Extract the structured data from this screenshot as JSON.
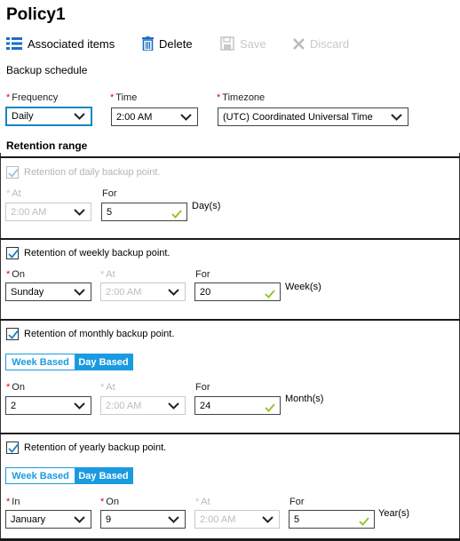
{
  "title": "Policy1",
  "toolbar": {
    "associated_items": "Associated items",
    "delete": "Delete",
    "save": "Save",
    "discard": "Discard"
  },
  "backup_schedule": {
    "heading": "Backup schedule",
    "frequency_label": "Frequency",
    "frequency_value": "Daily",
    "time_label": "Time",
    "time_value": "2:00 AM",
    "timezone_label": "Timezone",
    "timezone_value": "(UTC) Coordinated Universal Time"
  },
  "retention_range": {
    "heading": "Retention range"
  },
  "daily": {
    "checkbox_label": "Retention of daily backup point.",
    "checked": true,
    "disabled": true,
    "at_label": "At",
    "at_value": "2:00 AM",
    "for_label": "For",
    "for_value": "5",
    "unit": "Day(s)"
  },
  "weekly": {
    "checkbox_label": "Retention of weekly backup point.",
    "checked": true,
    "on_label": "On",
    "on_value": "Sunday",
    "at_label": "At",
    "at_value": "2:00 AM",
    "for_label": "For",
    "for_value": "20",
    "unit": "Week(s)"
  },
  "monthly": {
    "checkbox_label": "Retention of monthly backup point.",
    "checked": true,
    "toggle_week": "Week Based",
    "toggle_day": "Day Based",
    "selected": "Day Based",
    "on_label": "On",
    "on_value": "2",
    "at_label": "At",
    "at_value": "2:00 AM",
    "for_label": "For",
    "for_value": "24",
    "unit": "Month(s)"
  },
  "yearly": {
    "checkbox_label": "Retention of yearly backup point.",
    "checked": true,
    "toggle_week": "Week Based",
    "toggle_day": "Day Based",
    "selected": "Day Based",
    "in_label": "In",
    "in_value": "January",
    "on_label": "On",
    "on_value": "9",
    "at_label": "At",
    "at_value": "2:00 AM",
    "for_label": "For",
    "for_value": "5",
    "unit": "Year(s)"
  },
  "colors": {
    "accent": "#1a9be0",
    "focus": "#1486c6",
    "required": "#e00000",
    "valid_check": "#8fc31f"
  }
}
